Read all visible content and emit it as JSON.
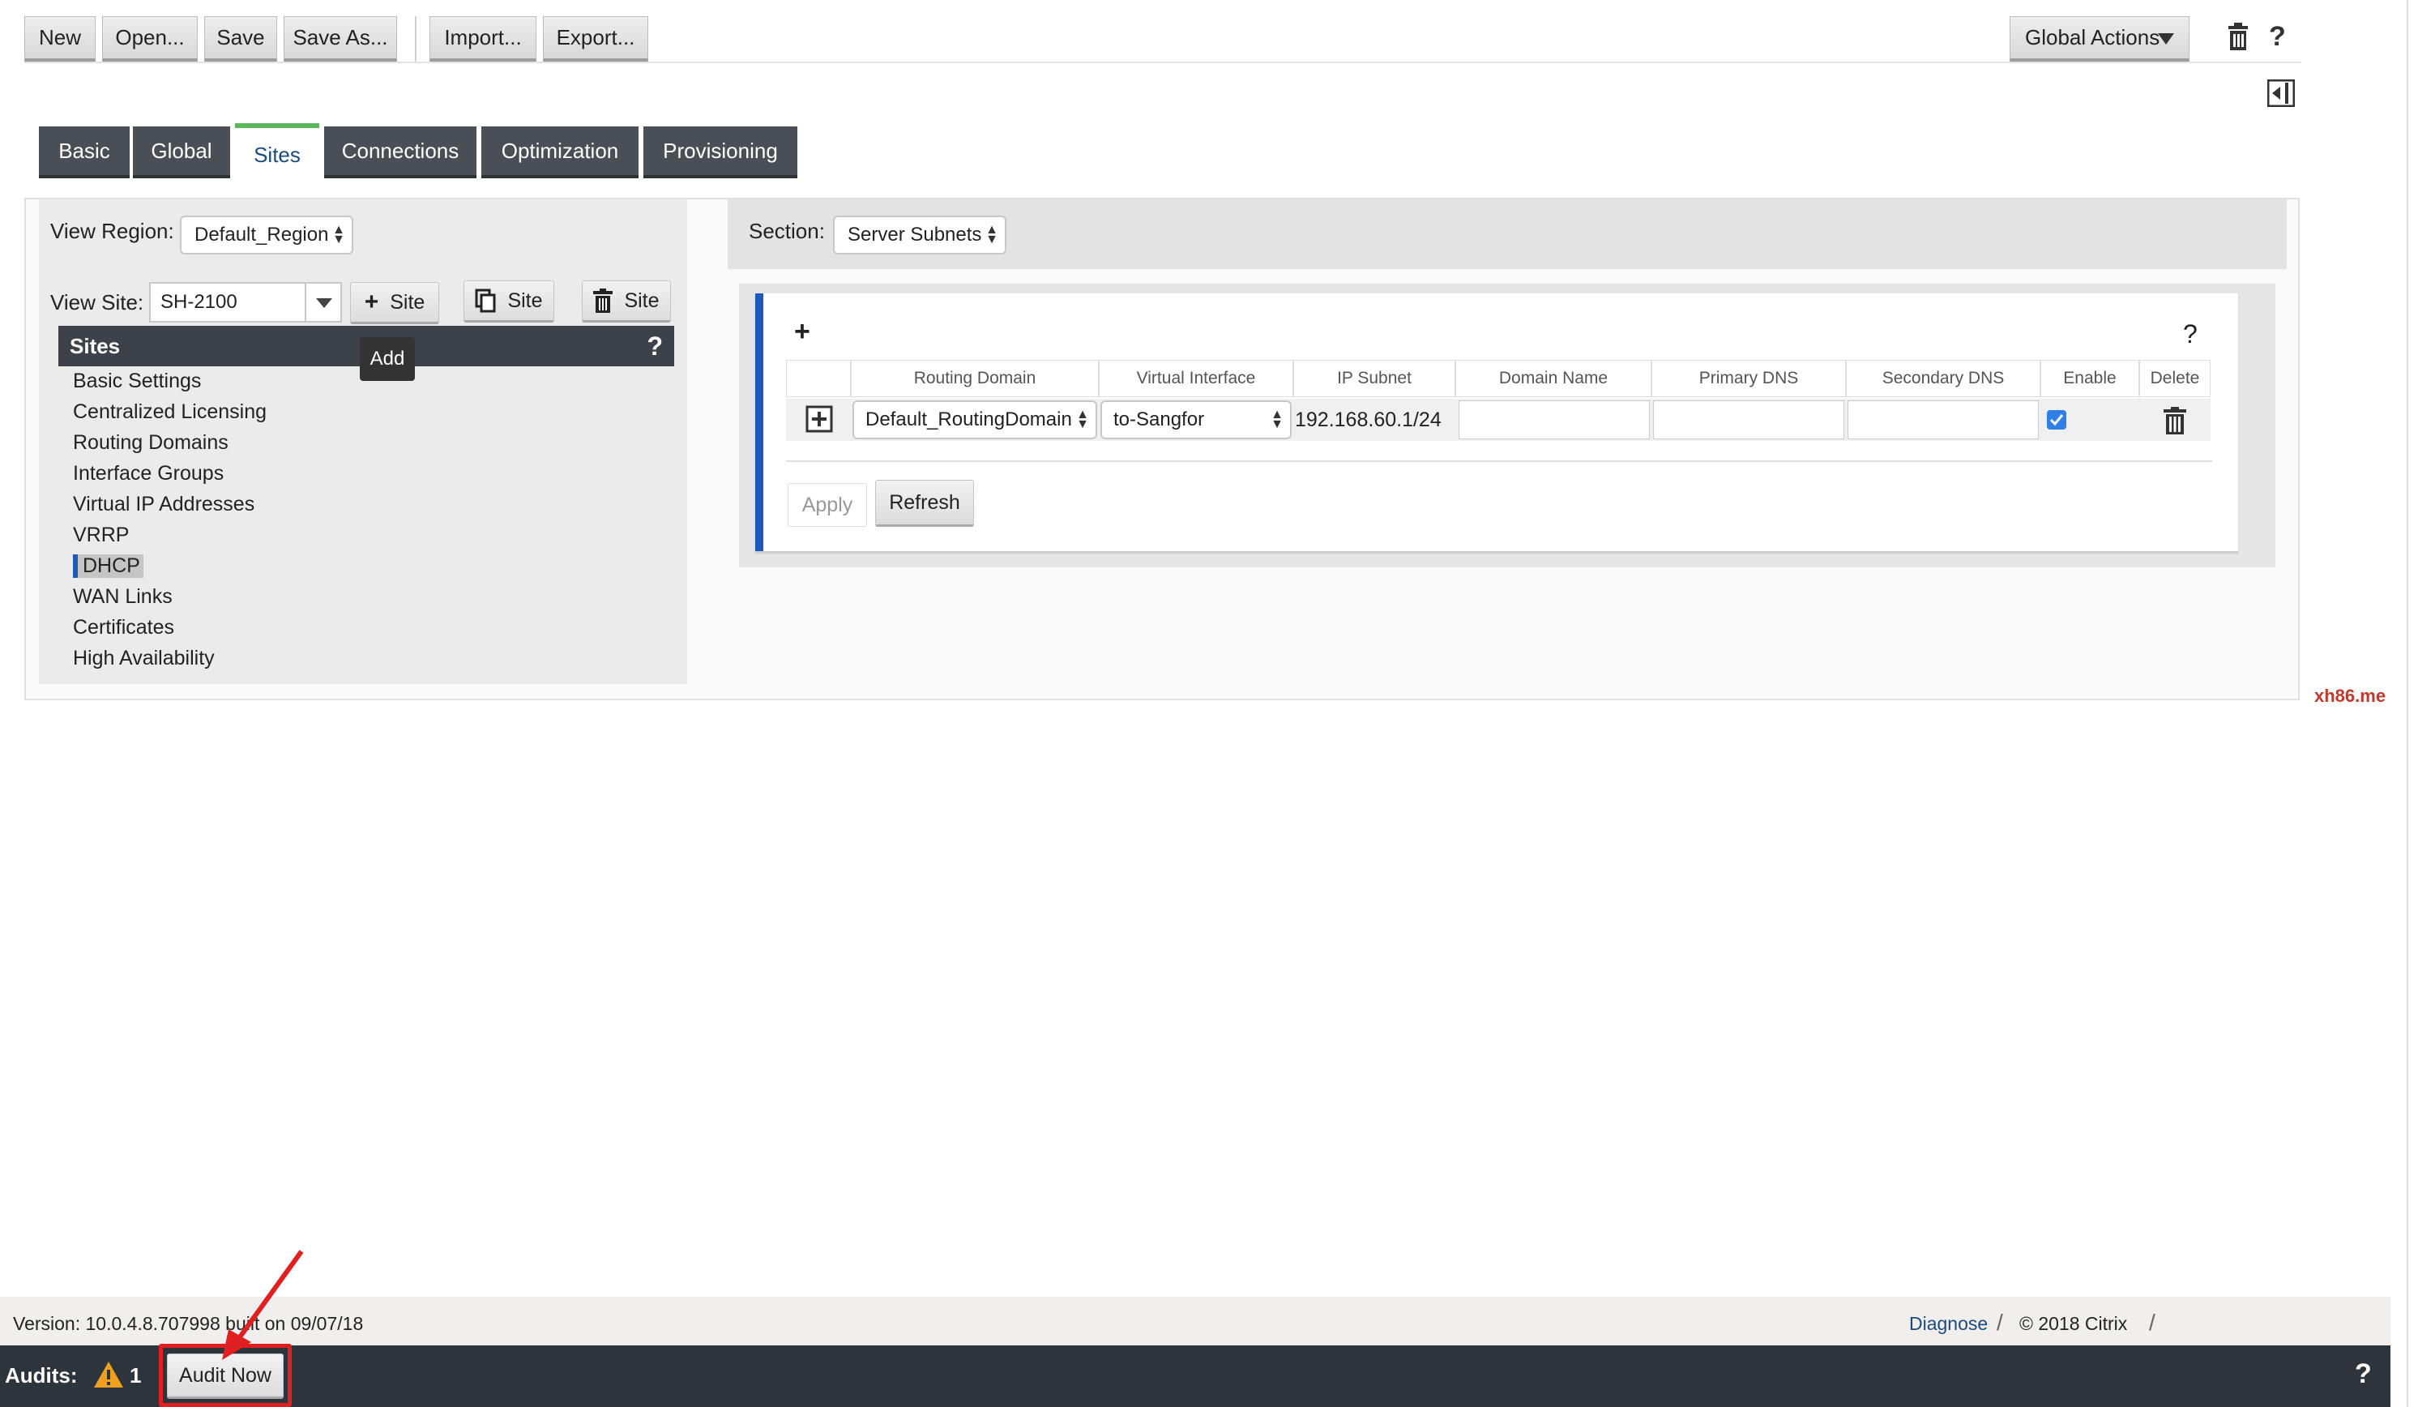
{
  "toolbar": {
    "new": "New",
    "open": "Open...",
    "save": "Save",
    "save_as": "Save As...",
    "import": "Import...",
    "export": "Export...",
    "global_actions": "Global Actions"
  },
  "tabs": [
    "Basic",
    "Global",
    "Sites",
    "Connections",
    "Optimization",
    "Provisioning"
  ],
  "left": {
    "view_region_label": "View Region:",
    "view_region_value": "Default_Region",
    "view_site_label": "View Site:",
    "view_site_value": "SH-2100",
    "add_site": "Site",
    "clone_site": "Site",
    "delete_site": "Site",
    "tooltip": "Add",
    "sites_header": "Sites",
    "help": "?",
    "nav_items": [
      "Basic Settings",
      "Centralized Licensing",
      "Routing Domains",
      "Interface Groups",
      "Virtual IP Addresses",
      "VRRP",
      "DHCP",
      "WAN Links",
      "Certificates",
      "High Availability"
    ]
  },
  "right": {
    "section_label": "Section:",
    "section_value": "Server Subnets",
    "plus": "+",
    "help": "?",
    "columns": [
      "Routing Domain",
      "Virtual Interface",
      "IP Subnet",
      "Domain Name",
      "Primary DNS",
      "Secondary DNS",
      "Enable",
      "Delete"
    ],
    "row": {
      "routing_domain": "Default_RoutingDomain",
      "virtual_interface": "to-Sangfor",
      "ip_subnet": "192.168.60.1/24",
      "domain_name": "",
      "primary_dns": "",
      "secondary_dns": "",
      "enabled": true
    },
    "apply": "Apply",
    "refresh": "Refresh"
  },
  "watermark": "xh86.me",
  "footer": {
    "version": "Version: 10.0.4.8.707998 built on 09/07/18",
    "diagnose": "Diagnose",
    "copyright": "© 2018 Citrix"
  },
  "audit": {
    "label": "Audits:",
    "count": "1",
    "button": "Audit Now",
    "help": "?"
  },
  "colors": {
    "accent_blue": "#1e5bb8",
    "active_tab_green": "#5cb85c",
    "dark_bar": "#2e343b",
    "highlight_red": "#e02020",
    "warning_orange": "#f0a020"
  }
}
